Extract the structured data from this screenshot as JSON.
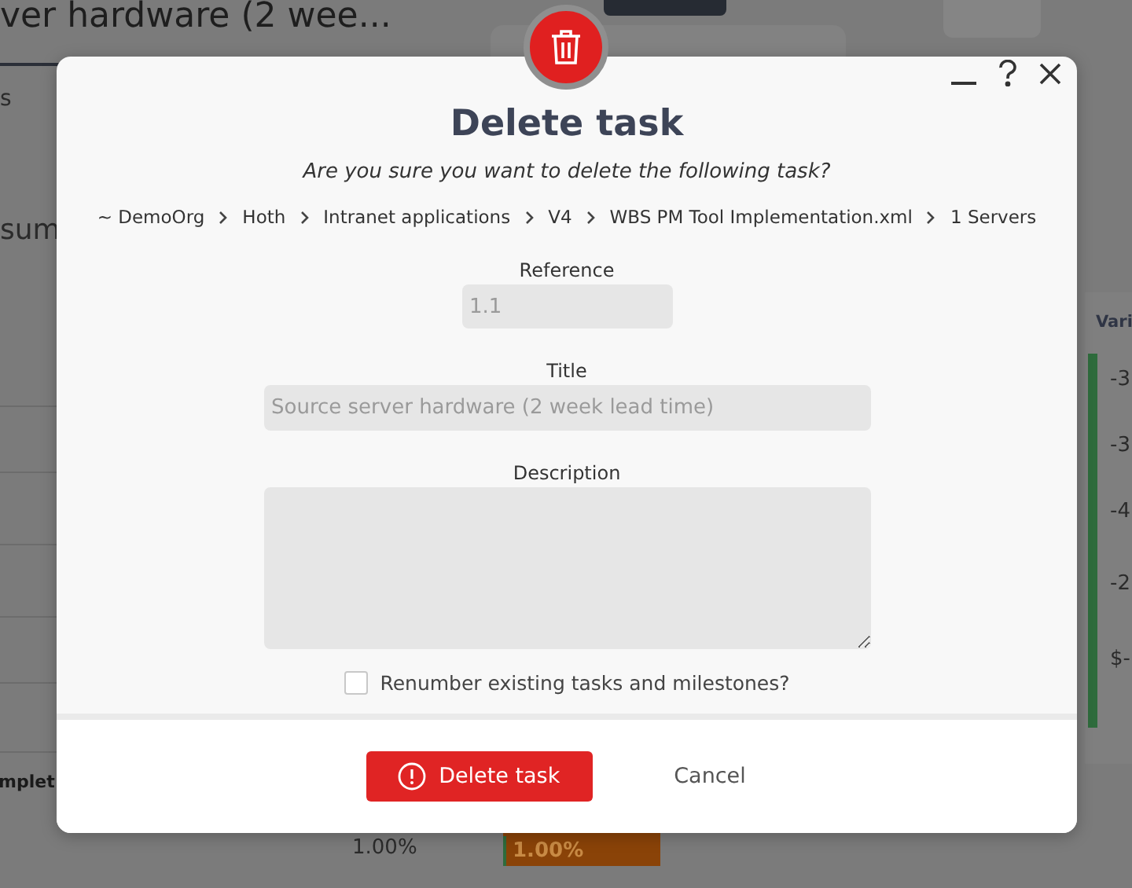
{
  "background": {
    "title": "ver hardware (2 wee...",
    "tab": "s",
    "heading": "sum",
    "row_label": "mplet",
    "column_header": "Vari",
    "variance_values": [
      "-3",
      "-3",
      "-4",
      "-2",
      "$-"
    ],
    "percent": "1.00%",
    "progress_bar": {
      "label": "1.00%",
      "level": 1
    }
  },
  "dialog": {
    "title": "Delete task",
    "question": "Are you sure you want to delete the following task?",
    "breadcrumb": [
      "~ DemoOrg",
      "Hoth",
      "Intranet applications",
      "V4",
      "WBS PM Tool Implementation.xml",
      "1 Servers"
    ],
    "fields": [
      {
        "label": "Reference",
        "value": "1.1",
        "kind": "short"
      },
      {
        "label": "Title",
        "value": "Source server hardware (2 week lead time)",
        "kind": "wide"
      },
      {
        "label": "Description",
        "kind": "area"
      }
    ],
    "renumber": {
      "label": "Renumber existing tasks and milestones?",
      "checked": false
    },
    "primary_button": "Delete task",
    "cancel_button": "Cancel"
  }
}
